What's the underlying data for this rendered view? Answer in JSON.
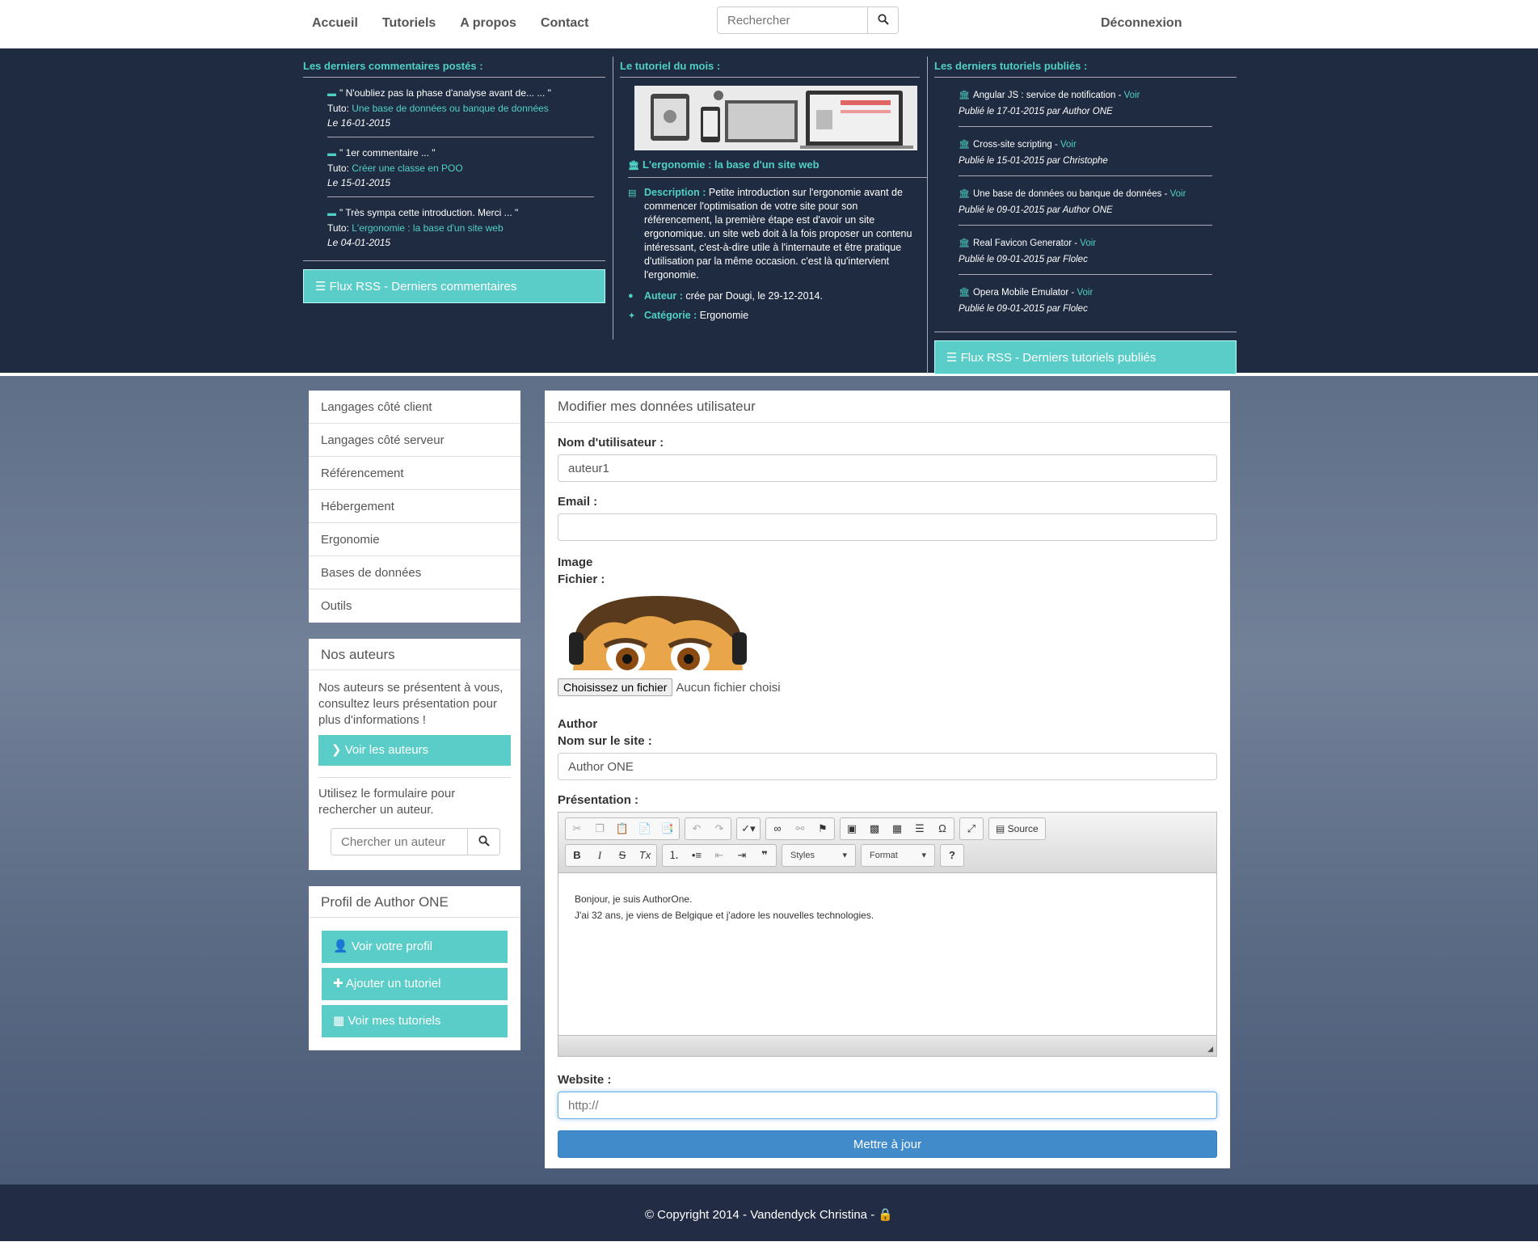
{
  "nav": {
    "links": [
      "Accueil",
      "Tutoriels",
      "A propos",
      "Contact"
    ],
    "search_placeholder": "Rechercher",
    "logout": "Déconnexion"
  },
  "comments": {
    "title": "Les derniers commentaires postés :",
    "items": [
      {
        "quote": "\" N'oubliez pas la phase d'analyse avant de... ... \"",
        "tuto_label": "Tuto:",
        "tuto": "Une base de données ou banque de données",
        "date": "Le 16-01-2015"
      },
      {
        "quote": "\" 1er commentaire ... \"",
        "tuto_label": "Tuto:",
        "tuto": "Créer une classe en POO",
        "date": "Le 15-01-2015"
      },
      {
        "quote": "\" Très sympa cette introduction. Merci ... \"",
        "tuto_label": "Tuto:",
        "tuto": "L'ergonomie : la base d'un site web",
        "date": "Le 04-01-2015"
      }
    ],
    "rss": "Flux RSS - Derniers commentaires"
  },
  "month": {
    "title": "Le tutoriel du mois :",
    "tuto_title": "L'ergonomie : la base d'un site web",
    "desc_label": "Description :",
    "desc": "Petite introduction sur l'ergonomie avant de commencer l'optimisation de votre site pour son référencement, la première étape est d'avoir un site ergonomique. un site web doit à la fois proposer un contenu intéressant, c'est-à-dire utile à l'internaute et être pratique d'utilisation par la même occasion. c'est là qu'intervient l'ergonomie.",
    "author_label": "Auteur :",
    "author": "crée par Dougi, le 29-12-2014.",
    "cat_label": "Catégorie :",
    "cat": "Ergonomie"
  },
  "tutorials": {
    "title": "Les derniers tutoriels publiés :",
    "see": "Voir",
    "items": [
      {
        "name": "Angular JS : service de notification",
        "date": "Publié le 17-01-2015 par Author ONE"
      },
      {
        "name": "Cross-site scripting",
        "date": "Publié le 15-01-2015 par Christophe"
      },
      {
        "name": "Une base de données ou banque de données",
        "date": "Publié le 09-01-2015 par Author ONE"
      },
      {
        "name": "Real Favicon Generator",
        "date": "Publié le 09-01-2015 par Flolec"
      },
      {
        "name": "Opera Mobile Emulator",
        "date": "Publié le 09-01-2015 par Flolec"
      }
    ],
    "rss": "Flux RSS - Derniers tutoriels publiés"
  },
  "sidebar": {
    "menu": [
      "Langages côté client",
      "Langages côté serveur",
      "Référencement",
      "Hébergement",
      "Ergonomie",
      "Bases de données",
      "Outils"
    ],
    "authors_title": "Nos auteurs",
    "authors_text": "Nos auteurs se présentent à vous, consultez leurs présentation pour plus d'informations !",
    "authors_btn": "Voir les auteurs",
    "authors_search_text": "Utilisez le formulaire pour rechercher un auteur.",
    "authors_search_placeholder": "Chercher un auteur",
    "profile_title": "Profil de Author ONE",
    "profile_btns": [
      "Voir votre profil",
      "Ajouter un tutoriel",
      "Voir mes tutoriels"
    ]
  },
  "form": {
    "title": "Modifier mes données utilisateur",
    "username_label": "Nom d'utilisateur :",
    "username": "auteur1",
    "email_label": "Email :",
    "email": "",
    "image_section": "Image",
    "file_label": "Fichier :",
    "file_btn": "Choisissez un fichier",
    "file_none": "Aucun fichier choisi",
    "author_section": "Author",
    "sitename_label": "Nom sur le site :",
    "sitename": "Author ONE",
    "presentation_label": "Présentation :",
    "presentation_lines": [
      "Bonjour, je suis AuthorOne.",
      "J'ai 32 ans, je viens de Belgique et j'adore les nouvelles technologies."
    ],
    "editor_source": "Source",
    "editor_styles": "Styles",
    "editor_format": "Format",
    "website_label": "Website :",
    "website_placeholder": "http://",
    "submit": "Mettre à jour"
  },
  "footer": {
    "text": "© Copyright 2014 - Vandendyck Christina -"
  },
  "colors": {
    "accent": "#5bcdc8",
    "band": "#1f2b41",
    "primary": "#428bca"
  }
}
